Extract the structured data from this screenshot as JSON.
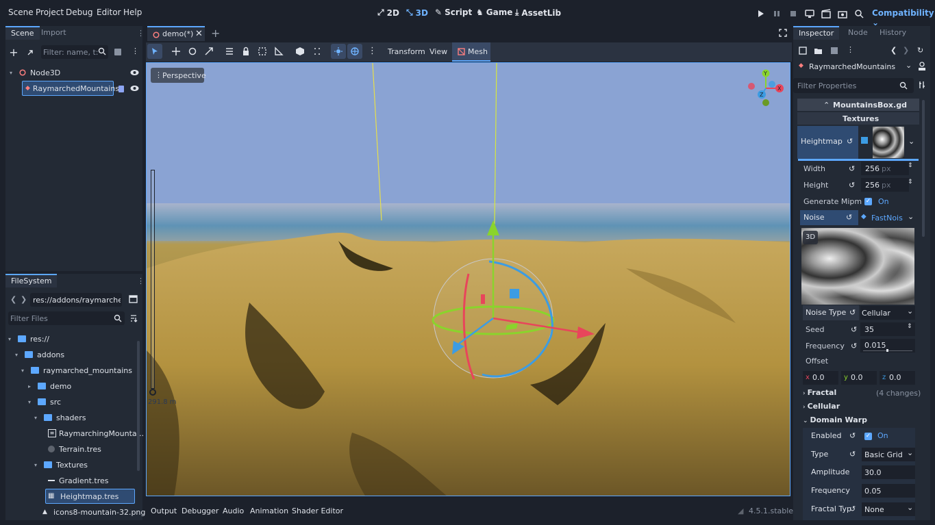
{
  "menu": [
    "Scene",
    "Project",
    "Debug",
    "Editor",
    "Help"
  ],
  "main_buttons": [
    {
      "label": "2D",
      "icon": "2d-icon"
    },
    {
      "label": "3D",
      "icon": "3d-icon",
      "active": true
    },
    {
      "label": "Script",
      "icon": "script-icon"
    },
    {
      "label": "Game",
      "icon": "game-icon"
    },
    {
      "label": "AssetLib",
      "icon": "assetlib-icon"
    }
  ],
  "renderer": "Compatibility",
  "scene_dock": {
    "tabs": [
      "Scene",
      "Import"
    ],
    "filter_placeholder": "Filter: name, t:ty",
    "nodes": [
      {
        "name": "Node3D",
        "icon": "node3d-icon"
      },
      {
        "name": "RaymarchedMountains",
        "icon": "meshinstance-icon",
        "selected": true
      }
    ]
  },
  "filesystem": {
    "tab": "FileSystem",
    "path": "res://addons/raymarched_",
    "filter_placeholder": "Filter Files",
    "items": [
      {
        "name": "res://",
        "type": "folder",
        "depth": 0
      },
      {
        "name": "addons",
        "type": "folder",
        "depth": 1
      },
      {
        "name": "raymarched_mountains",
        "type": "folder",
        "depth": 2
      },
      {
        "name": "demo",
        "type": "folder",
        "depth": 3,
        "collapsed": true
      },
      {
        "name": "src",
        "type": "folder",
        "depth": 3
      },
      {
        "name": "shaders",
        "type": "folder",
        "depth": 4
      },
      {
        "name": "RaymarchingMounta...",
        "type": "shader",
        "depth": 5
      },
      {
        "name": "Terrain.tres",
        "type": "resource",
        "depth": 5
      },
      {
        "name": "Textures",
        "type": "folder",
        "depth": 4
      },
      {
        "name": "Gradient.tres",
        "type": "gradient",
        "depth": 5
      },
      {
        "name": "Heightmap.tres",
        "type": "noise",
        "depth": 5,
        "selected": true
      },
      {
        "name": "icons8-mountain-32.png",
        "type": "image",
        "depth": 4
      }
    ]
  },
  "editor_tab": {
    "label": "demo(*)"
  },
  "viewport_toolbar": {
    "menus": [
      "Transform",
      "View"
    ],
    "mesh_label": "Mesh"
  },
  "viewport": {
    "perspective_label": "Perspective",
    "height_readout": "291.8 m"
  },
  "bottom_tabs": [
    "Output",
    "Debugger",
    "Audio",
    "Animation",
    "Shader Editor"
  ],
  "version": "4.5.1.stable",
  "inspector": {
    "tabs": [
      "Inspector",
      "Node",
      "History"
    ],
    "object_name": "RaymarchedMountains",
    "filter_placeholder": "Filter Properties",
    "script_name": "MountainsBox.gd",
    "category": "Textures",
    "heightmap_label": "Heightmap",
    "width": {
      "label": "Width",
      "value": "256",
      "unit": "px"
    },
    "height": {
      "label": "Height",
      "value": "256",
      "unit": "px"
    },
    "mipmaps": {
      "label": "Generate Mipm",
      "value": "On"
    },
    "noise": {
      "label": "Noise",
      "value": "FastNois"
    },
    "preview_badge": "3D",
    "noise_type": {
      "label": "Noise Type",
      "value": "Cellular"
    },
    "seed": {
      "label": "Seed",
      "value": "35"
    },
    "frequency": {
      "label": "Frequency",
      "value": "0.015"
    },
    "offset": {
      "label": "Offset",
      "x": "0.0",
      "y": "0.0",
      "z": "0.0"
    },
    "fractal": {
      "label": "Fractal",
      "note": "(4 changes)"
    },
    "cellular": "Cellular",
    "domain_warp": "Domain Warp",
    "dw_enabled": {
      "label": "Enabled",
      "value": "On"
    },
    "dw_type": {
      "label": "Type",
      "value": "Basic Grid"
    },
    "dw_amplitude": {
      "label": "Amplitude",
      "value": "30.0"
    },
    "dw_frequency": {
      "label": "Frequency",
      "value": "0.05"
    },
    "dw_fractal": {
      "label": "Fractal Typ",
      "value": "None"
    }
  },
  "colors": {
    "accent": "#5da8ff",
    "x_axis": "#e8455b",
    "y_axis": "#8ad42c",
    "z_axis": "#3c9ce3"
  }
}
